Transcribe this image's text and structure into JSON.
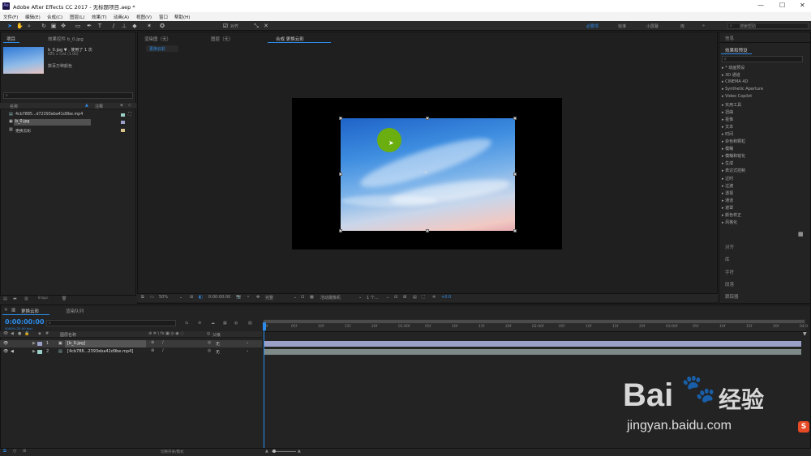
{
  "window": {
    "title": "Adobe After Effects CC 2017 - 无标题项目.aep *",
    "logo": "Ae",
    "controls": [
      "—",
      "☐",
      "✕"
    ]
  },
  "menu": [
    "文件(F)",
    "编辑(E)",
    "合成(C)",
    "图层(L)",
    "效果(T)",
    "动画(A)",
    "视图(V)",
    "窗口",
    "帮助(H)"
  ],
  "toolbar": {
    "align_label": "对齐",
    "workspaces": [
      "必要项",
      "标准",
      "小屏幕",
      "库"
    ],
    "active_workspace": "必要项",
    "search_placeholder": "搜索帮助"
  },
  "project": {
    "tab_project": "项目",
    "tab_effects": "效果控件 b_0.jpg",
    "item_name": "b_0.jpg ▼ , 使用了 1 次",
    "item_dims": "625 x 534 (1.00)",
    "item_color": "数百万种颜色",
    "col_name": "名称",
    "col_comment": "注释",
    "items": [
      "4cb7885...d72393eba41d9be.mp4",
      "b_0.jpg",
      "更换云彩"
    ],
    "bpc": "8 bpc"
  },
  "viewer": {
    "tabs": [
      "渲染图（无）",
      "图层（无）",
      "合成 更换云彩"
    ],
    "sub_tab": "更换云彩",
    "zoom": "50%",
    "timecode": "0:00:00:00",
    "quality": "完整",
    "camera": "活动摄像机",
    "views": "1 个...",
    "exposure": "+0.0"
  },
  "right": {
    "info_tab": "信息",
    "effects_title": "效果和预设",
    "effect_categories": [
      "* 动画预设",
      "3D 通道",
      "CINEMA 4D",
      "Synthetic Aperture",
      "Video Copilot",
      "实用工具",
      "扭曲",
      "抠像",
      "文本",
      "时间",
      "杂色和颗粒",
      "模糊",
      "模糊和锐化",
      "生成",
      "表达式控制",
      "过时",
      "过渡",
      "透视",
      "通道",
      "遮罩",
      "颜色校正",
      "风格化"
    ],
    "panels": [
      "对齐",
      "库",
      "字符",
      "段落",
      "跟踪器"
    ]
  },
  "timeline": {
    "tab_comp": "更换云彩",
    "tab_render": "渲染队列",
    "timecode": "0:00:00:00",
    "frames": "00000 (25.00 fps)",
    "col_source": "图层名称",
    "col_parent": "父级",
    "layers": [
      {
        "num": "1",
        "name": "[b_0.jpg]",
        "parent": "无"
      },
      {
        "num": "2",
        "name": "[4cb788...2393eba41d9be.mp4]",
        "parent": "无"
      }
    ],
    "ticks": [
      "0f",
      "05f",
      "10f",
      "15f",
      "20f",
      "01:00f",
      "05f",
      "10f",
      "15f",
      "20f",
      "02:00f",
      "05f",
      "10f",
      "15f",
      "20f",
      "03:00f",
      "05f",
      "10f",
      "15f",
      "20f",
      "04:0"
    ],
    "footer": "切换开关/模式"
  },
  "watermark": {
    "brand": "Bai",
    "brand2": "经验",
    "url": "jingyan.baidu.com"
  },
  "colors": {
    "accent": "#2d8ceb",
    "layer_bar": "#9aa0c8",
    "layer_bar2": "#7e8a88",
    "cursor_dot": "#6aae10"
  }
}
